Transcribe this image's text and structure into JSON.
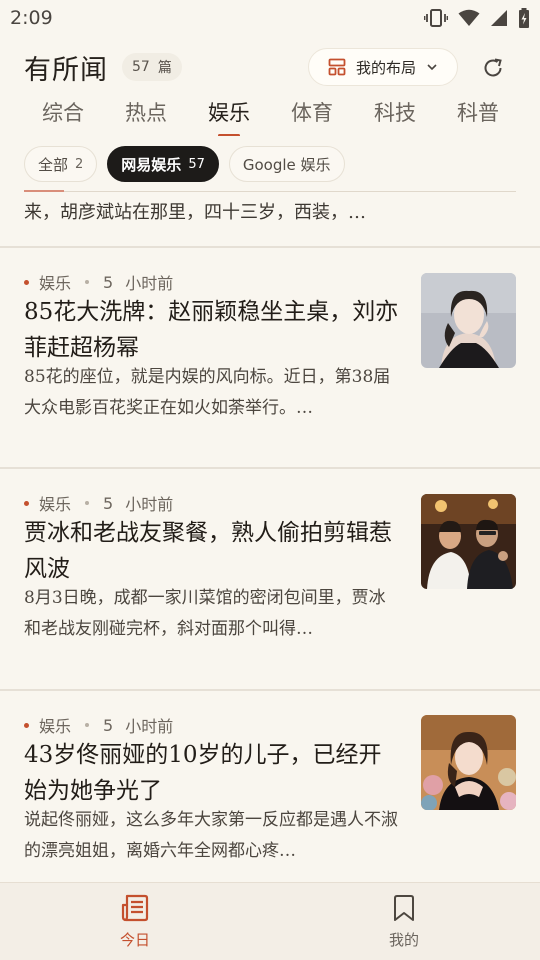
{
  "status_bar": {
    "time": "2:09"
  },
  "header": {
    "app_title": "有所闻",
    "article_count": "57",
    "article_unit": "篇",
    "layout_button_label": "我的布局"
  },
  "tabs": [
    {
      "label": "综合",
      "active": false
    },
    {
      "label": "热点",
      "active": false
    },
    {
      "label": "娱乐",
      "active": true
    },
    {
      "label": "体育",
      "active": false
    },
    {
      "label": "科技",
      "active": false
    },
    {
      "label": "科普",
      "active": false
    }
  ],
  "chips": [
    {
      "label": "全部",
      "count": "2",
      "active": false
    },
    {
      "label": "网易娱乐",
      "count": "57",
      "active": true
    },
    {
      "label": "Google 娱乐",
      "count": "",
      "active": false
    }
  ],
  "feed": {
    "partial_summary": "来，胡彦斌站在那里，四十三岁，西装，…",
    "articles": [
      {
        "category": "娱乐",
        "time_value": "5",
        "time_unit": "小时前",
        "title": "85花大洗牌：赵丽颖稳坐主桌，刘亦菲赶超杨幂",
        "summary": "85花的座位，就是内娱的风向标。近日，第38届大众电影百花奖正在如火如荼举行。…"
      },
      {
        "category": "娱乐",
        "time_value": "5",
        "time_unit": "小时前",
        "title": "贾冰和老战友聚餐，熟人偷拍剪辑惹风波",
        "summary": "8月3日晚，成都一家川菜馆的密闭包间里，贾冰和老战友刚碰完杯，斜对面那个叫得…"
      },
      {
        "category": "娱乐",
        "time_value": "5",
        "time_unit": "小时前",
        "title": "43岁佟丽娅的10岁的儿子，已经开始为她争光了",
        "summary": "说起佟丽娅，这么多年大家第一反应都是遇人不淑的漂亮姐姐，离婚六年全网都心疼…"
      }
    ]
  },
  "bottom_nav": [
    {
      "label": "今日",
      "active": true
    },
    {
      "label": "我的",
      "active": false
    }
  ],
  "colors": {
    "accent": "#c4502e",
    "background": "#f9f6ef",
    "chip_active": "#1d1b19"
  }
}
